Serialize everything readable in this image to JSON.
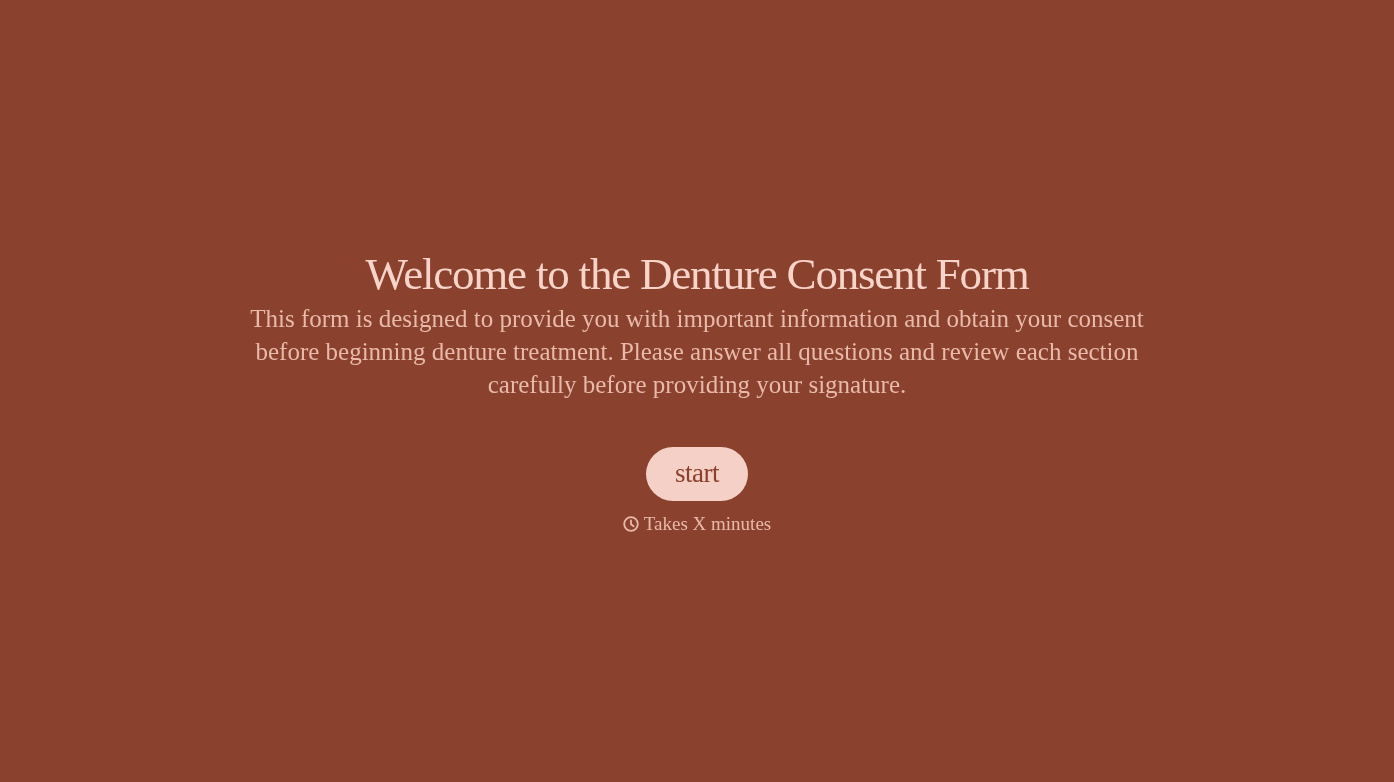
{
  "title": "Welcome to the Denture Consent Form",
  "description": "This form is designed to provide you with important information and obtain your consent before beginning denture treatment. Please answer all questions and review each section carefully before providing your signature.",
  "start_button": "start",
  "duration": "Takes X minutes"
}
